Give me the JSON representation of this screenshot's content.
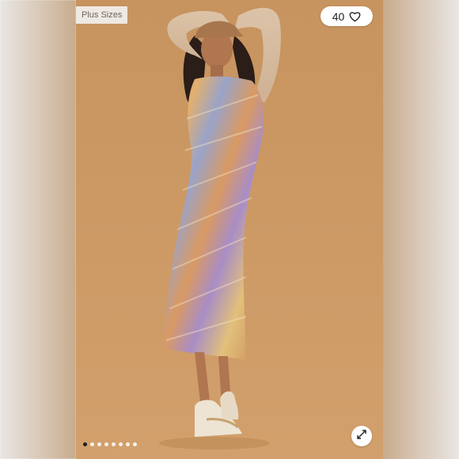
{
  "listing": {
    "size_tag": "Plus Sizes",
    "like_count": "40",
    "heart_icon": "heart-outline-icon",
    "expand_icon": "expand-arrows-icon"
  },
  "carousel": {
    "total_images": 8,
    "active_index": 0
  },
  "colors": {
    "backdrop": "#c99a66",
    "tag_bg": "#efe9e3",
    "active_dot": "#1f1f1f"
  }
}
